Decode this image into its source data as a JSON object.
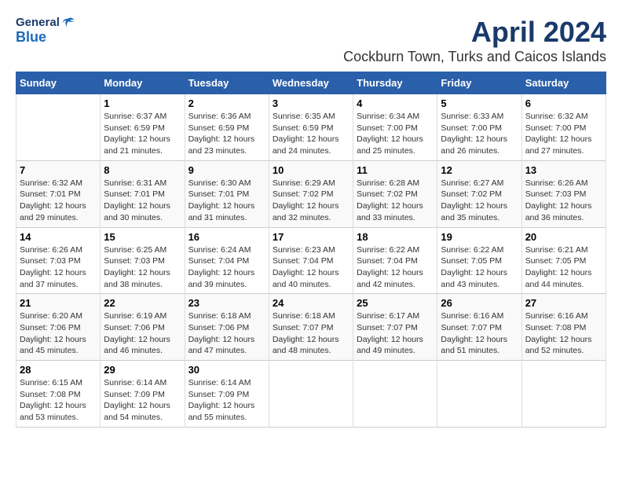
{
  "header": {
    "logo_general": "General",
    "logo_blue": "Blue",
    "month_year": "April 2024",
    "location": "Cockburn Town, Turks and Caicos Islands"
  },
  "days_of_week": [
    "Sunday",
    "Monday",
    "Tuesday",
    "Wednesday",
    "Thursday",
    "Friday",
    "Saturday"
  ],
  "weeks": [
    [
      {
        "day": "",
        "content": ""
      },
      {
        "day": "1",
        "content": "Sunrise: 6:37 AM\nSunset: 6:59 PM\nDaylight: 12 hours\nand 21 minutes."
      },
      {
        "day": "2",
        "content": "Sunrise: 6:36 AM\nSunset: 6:59 PM\nDaylight: 12 hours\nand 23 minutes."
      },
      {
        "day": "3",
        "content": "Sunrise: 6:35 AM\nSunset: 6:59 PM\nDaylight: 12 hours\nand 24 minutes."
      },
      {
        "day": "4",
        "content": "Sunrise: 6:34 AM\nSunset: 7:00 PM\nDaylight: 12 hours\nand 25 minutes."
      },
      {
        "day": "5",
        "content": "Sunrise: 6:33 AM\nSunset: 7:00 PM\nDaylight: 12 hours\nand 26 minutes."
      },
      {
        "day": "6",
        "content": "Sunrise: 6:32 AM\nSunset: 7:00 PM\nDaylight: 12 hours\nand 27 minutes."
      }
    ],
    [
      {
        "day": "7",
        "content": "Sunrise: 6:32 AM\nSunset: 7:01 PM\nDaylight: 12 hours\nand 29 minutes."
      },
      {
        "day": "8",
        "content": "Sunrise: 6:31 AM\nSunset: 7:01 PM\nDaylight: 12 hours\nand 30 minutes."
      },
      {
        "day": "9",
        "content": "Sunrise: 6:30 AM\nSunset: 7:01 PM\nDaylight: 12 hours\nand 31 minutes."
      },
      {
        "day": "10",
        "content": "Sunrise: 6:29 AM\nSunset: 7:02 PM\nDaylight: 12 hours\nand 32 minutes."
      },
      {
        "day": "11",
        "content": "Sunrise: 6:28 AM\nSunset: 7:02 PM\nDaylight: 12 hours\nand 33 minutes."
      },
      {
        "day": "12",
        "content": "Sunrise: 6:27 AM\nSunset: 7:02 PM\nDaylight: 12 hours\nand 35 minutes."
      },
      {
        "day": "13",
        "content": "Sunrise: 6:26 AM\nSunset: 7:03 PM\nDaylight: 12 hours\nand 36 minutes."
      }
    ],
    [
      {
        "day": "14",
        "content": "Sunrise: 6:26 AM\nSunset: 7:03 PM\nDaylight: 12 hours\nand 37 minutes."
      },
      {
        "day": "15",
        "content": "Sunrise: 6:25 AM\nSunset: 7:03 PM\nDaylight: 12 hours\nand 38 minutes."
      },
      {
        "day": "16",
        "content": "Sunrise: 6:24 AM\nSunset: 7:04 PM\nDaylight: 12 hours\nand 39 minutes."
      },
      {
        "day": "17",
        "content": "Sunrise: 6:23 AM\nSunset: 7:04 PM\nDaylight: 12 hours\nand 40 minutes."
      },
      {
        "day": "18",
        "content": "Sunrise: 6:22 AM\nSunset: 7:04 PM\nDaylight: 12 hours\nand 42 minutes."
      },
      {
        "day": "19",
        "content": "Sunrise: 6:22 AM\nSunset: 7:05 PM\nDaylight: 12 hours\nand 43 minutes."
      },
      {
        "day": "20",
        "content": "Sunrise: 6:21 AM\nSunset: 7:05 PM\nDaylight: 12 hours\nand 44 minutes."
      }
    ],
    [
      {
        "day": "21",
        "content": "Sunrise: 6:20 AM\nSunset: 7:06 PM\nDaylight: 12 hours\nand 45 minutes."
      },
      {
        "day": "22",
        "content": "Sunrise: 6:19 AM\nSunset: 7:06 PM\nDaylight: 12 hours\nand 46 minutes."
      },
      {
        "day": "23",
        "content": "Sunrise: 6:18 AM\nSunset: 7:06 PM\nDaylight: 12 hours\nand 47 minutes."
      },
      {
        "day": "24",
        "content": "Sunrise: 6:18 AM\nSunset: 7:07 PM\nDaylight: 12 hours\nand 48 minutes."
      },
      {
        "day": "25",
        "content": "Sunrise: 6:17 AM\nSunset: 7:07 PM\nDaylight: 12 hours\nand 49 minutes."
      },
      {
        "day": "26",
        "content": "Sunrise: 6:16 AM\nSunset: 7:07 PM\nDaylight: 12 hours\nand 51 minutes."
      },
      {
        "day": "27",
        "content": "Sunrise: 6:16 AM\nSunset: 7:08 PM\nDaylight: 12 hours\nand 52 minutes."
      }
    ],
    [
      {
        "day": "28",
        "content": "Sunrise: 6:15 AM\nSunset: 7:08 PM\nDaylight: 12 hours\nand 53 minutes."
      },
      {
        "day": "29",
        "content": "Sunrise: 6:14 AM\nSunset: 7:09 PM\nDaylight: 12 hours\nand 54 minutes."
      },
      {
        "day": "30",
        "content": "Sunrise: 6:14 AM\nSunset: 7:09 PM\nDaylight: 12 hours\nand 55 minutes."
      },
      {
        "day": "",
        "content": ""
      },
      {
        "day": "",
        "content": ""
      },
      {
        "day": "",
        "content": ""
      },
      {
        "day": "",
        "content": ""
      }
    ]
  ]
}
